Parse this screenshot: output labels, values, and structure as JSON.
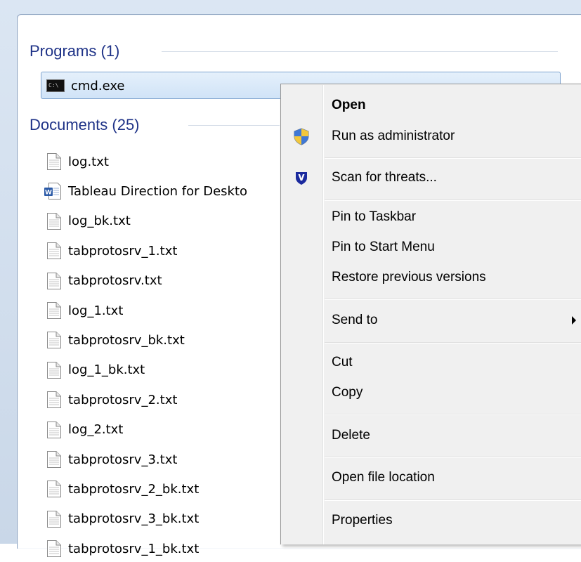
{
  "programs": {
    "header": "Programs (1)",
    "items": [
      {
        "label": "cmd.exe",
        "icon": "cmd-icon"
      }
    ]
  },
  "documents": {
    "header": "Documents (25)",
    "items": [
      {
        "label": "log.txt",
        "icon": "text-file-icon"
      },
      {
        "label": "Tableau Direction for Deskto",
        "icon": "word-doc-icon"
      },
      {
        "label": "log_bk.txt",
        "icon": "text-file-icon"
      },
      {
        "label": "tabprotosrv_1.txt",
        "icon": "text-file-icon"
      },
      {
        "label": "tabprotosrv.txt",
        "icon": "text-file-icon"
      },
      {
        "label": "log_1.txt",
        "icon": "text-file-icon"
      },
      {
        "label": "tabprotosrv_bk.txt",
        "icon": "text-file-icon"
      },
      {
        "label": "log_1_bk.txt",
        "icon": "text-file-icon"
      },
      {
        "label": "tabprotosrv_2.txt",
        "icon": "text-file-icon"
      },
      {
        "label": "log_2.txt",
        "icon": "text-file-icon"
      },
      {
        "label": "tabprotosrv_3.txt",
        "icon": "text-file-icon"
      },
      {
        "label": "tabprotosrv_2_bk.txt",
        "icon": "text-file-icon"
      },
      {
        "label": "tabprotosrv_3_bk.txt",
        "icon": "text-file-icon"
      },
      {
        "label": "tabprotosrv_1_bk.txt",
        "icon": "text-file-icon"
      }
    ]
  },
  "context_menu": {
    "open": "Open",
    "run_as_admin": "Run as administrator",
    "scan": "Scan for threats...",
    "pin_taskbar": "Pin to Taskbar",
    "pin_start": "Pin to Start Menu",
    "restore": "Restore previous versions",
    "send_to": "Send to",
    "cut": "Cut",
    "copy": "Copy",
    "delete": "Delete",
    "open_location": "Open file location",
    "properties": "Properties"
  },
  "colors": {
    "header_text": "#1e3287",
    "selection_border": "#7da2ce",
    "menu_background": "#f0f0f0"
  }
}
